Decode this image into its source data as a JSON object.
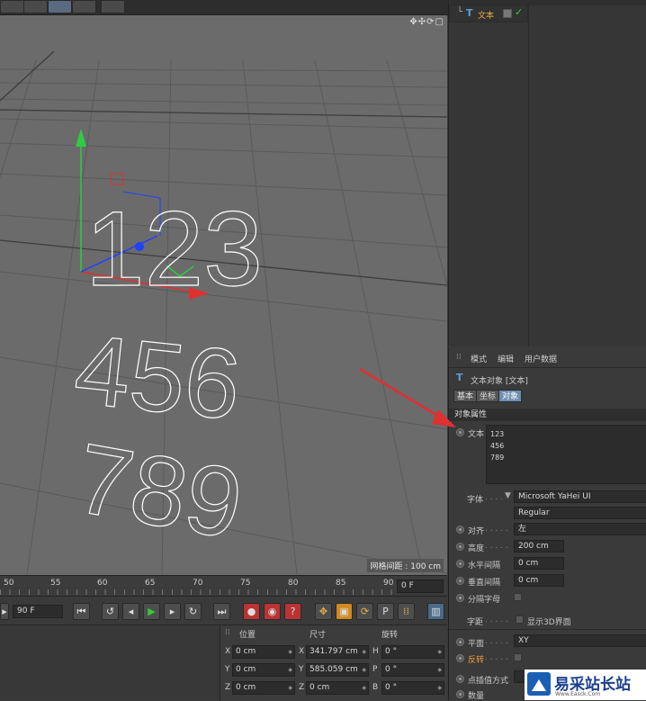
{
  "viewport": {
    "grid_spacing_label": "网格间距 : 100 cm",
    "text_lines": [
      "123",
      "456",
      "789"
    ]
  },
  "object_list": {
    "object_name": "文本"
  },
  "attributes": {
    "menu": [
      "模式",
      "编辑",
      "用户数据"
    ],
    "object_title": "文本对象 [文本]",
    "tabs": [
      "基本",
      "坐标",
      "对象"
    ],
    "active_tab": "对象",
    "section_title": "对象属性",
    "text_label": "文本",
    "text_value": "123\n456\n789",
    "font_label": "字体",
    "font_value": "Microsoft YaHei UI",
    "font_style": "Regular",
    "align_label": "对齐",
    "align_value": "左",
    "height_label": "高度",
    "height_value": "200 cm",
    "h_spacing_label": "水平间隔",
    "h_spacing_value": "0 cm",
    "v_spacing_label": "垂直间隔",
    "v_spacing_value": "0 cm",
    "separate_label": "分隔字母",
    "kerning_label": "字距",
    "show3d_label": "显示3D界面",
    "plane_label": "平面",
    "plane_value": "XY",
    "reverse_label": "反转",
    "point_interp_label": "点插值方式",
    "count_label": "数量"
  },
  "timeline": {
    "ticks": [
      "50",
      "55",
      "60",
      "65",
      "70",
      "75",
      "80",
      "85",
      "90"
    ],
    "current_frame": "0 F"
  },
  "transport": {
    "end_frame": "90 F"
  },
  "coordinates": {
    "headers": [
      "位置",
      "尺寸",
      "旋转"
    ],
    "position": [
      {
        "axis": "X",
        "value": "0 cm"
      },
      {
        "axis": "Y",
        "value": "0 cm"
      },
      {
        "axis": "Z",
        "value": "0 cm"
      }
    ],
    "size": [
      {
        "axis": "X",
        "value": "341.797 cm"
      },
      {
        "axis": "Y",
        "value": "585.059 cm"
      },
      {
        "axis": "Z",
        "value": "0 cm"
      }
    ],
    "rotation": [
      {
        "axis": "H",
        "value": "0 °"
      },
      {
        "axis": "P",
        "value": "0 °"
      },
      {
        "axis": "B",
        "value": "0 °"
      }
    ]
  },
  "watermark": {
    "title": "易采站长站",
    "url": "Www.Easck.Com"
  },
  "colors": {
    "accent_tab": "#6c8fb0",
    "arrow_red": "#e03030",
    "axis_green": "#2ecc40",
    "axis_blue": "#2040ff"
  }
}
